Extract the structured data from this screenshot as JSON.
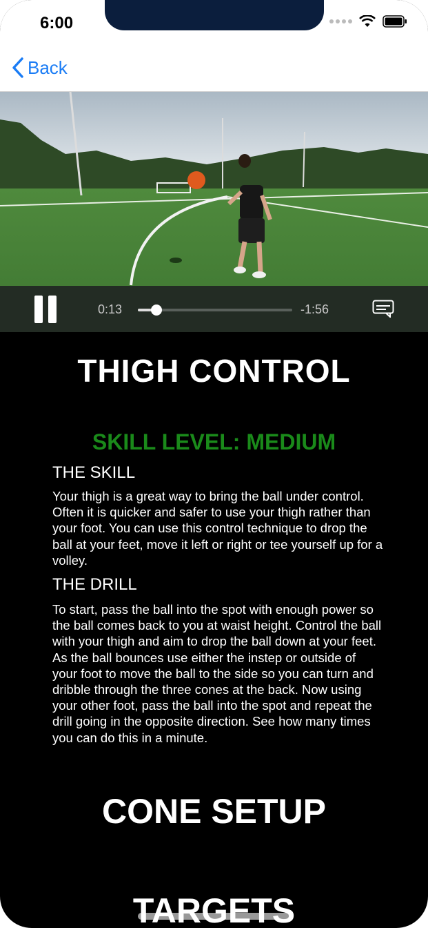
{
  "status_bar": {
    "time": "6:00"
  },
  "nav": {
    "back_label": "Back"
  },
  "video": {
    "elapsed": "0:13",
    "remaining": "-1:56",
    "progress": 0.12
  },
  "content": {
    "title": "THIGH CONTROL",
    "skill_level": "SKILL LEVEL: MEDIUM",
    "skill_heading": "THE SKILL",
    "skill_text": "Your thigh is a great way to bring the ball under control. Often it is quicker and safer to use your thigh rather than your foot. You can use this control technique to drop the ball at your feet, move it left or right or tee yourself up for a volley.",
    "drill_heading": "THE DRILL",
    "drill_text": "To start, pass the ball into the spot with enough power so the ball comes back to you at waist height. Control the ball with your thigh and aim to drop the ball down at your feet. As the ball bounces use either the instep or outside of your foot to move the ball to the side so you can turn and dribble through the three cones at the back. Now using your other foot, pass the ball into the spot and repeat the drill going in the opposite direction. See how many times you can do this in a minute.",
    "cone_setup": "CONE SETUP",
    "targets": "TARGETS"
  },
  "colors": {
    "accent": "#1a7cf5",
    "skill_level": "#1a8a1a"
  }
}
